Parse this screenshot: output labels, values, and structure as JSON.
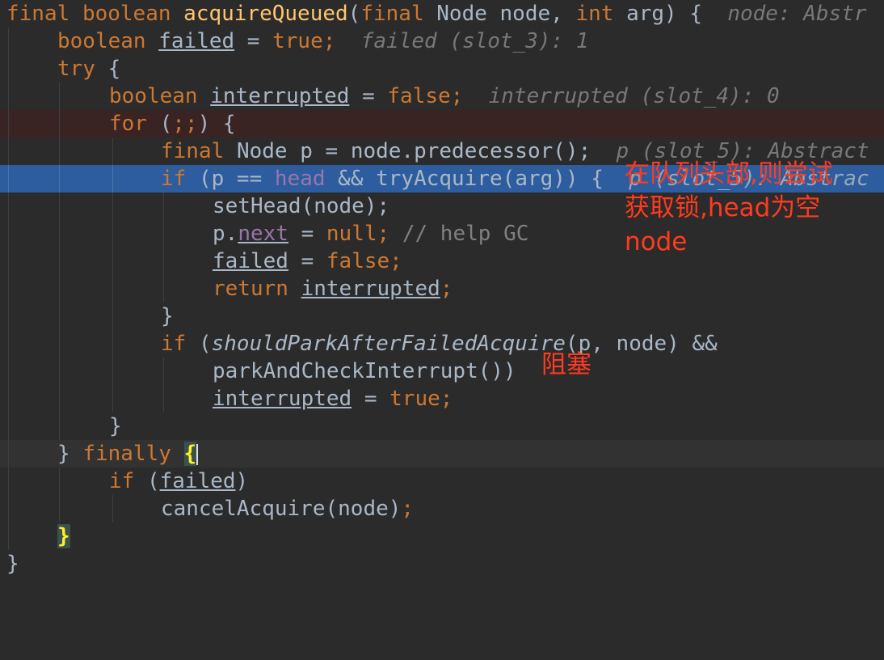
{
  "code": {
    "l1": {
      "kw_final": "final",
      "kw_boolean": "boolean",
      "method": "acquireQueued",
      "paren": "(",
      "kw_final2": "final",
      "type_node": "Node node,",
      "kw_int": "int",
      "param_arg": "arg) {",
      "hint": "node: Abstr"
    },
    "l2": {
      "kw_boolean": "boolean",
      "var": "failed",
      "assign": " = ",
      "kw_true": "true",
      "semi": ";",
      "hint": "failed (slot_3): 1"
    },
    "l3": {
      "kw_try": "try",
      "brace": " {"
    },
    "l4": {
      "kw_boolean": "boolean",
      "var": "interrupted",
      "assign": " = ",
      "kw_false": "false",
      "semi": ";",
      "hint": "interrupted (slot_4): 0"
    },
    "l5": {
      "kw_for": "for",
      "rest": " (",
      "semis": ";;",
      "close": ") {"
    },
    "l6": {
      "kw_final": "final",
      "decl": "Node p = node.predecessor();",
      "hint": "p (slot_5): Abstract"
    },
    "l7": {
      "kw_if": "if",
      "open": " (p == ",
      "field_head": "head",
      "rest": " && tryAcquire(arg)) {",
      "hint": "p (slot_5): Abstrac"
    },
    "l8": {
      "stmt": "setHead(node);"
    },
    "l9": {
      "p": "p.",
      "field_next": "next",
      "assign": " = ",
      "kw_null": "null",
      "semi": ";",
      "comment": "// help GC"
    },
    "l10": {
      "var": "failed",
      "assign": " = ",
      "kw_false": "false",
      "semi": ";"
    },
    "l11": {
      "kw_return": "return",
      "var": "interrupted",
      "semi": ";"
    },
    "l12": {
      "brace": "}"
    },
    "l13": {
      "kw_if": "if",
      "open": " (",
      "call": "shouldParkAfterFailedAcquire",
      "args": "(p, node) &&"
    },
    "l14": {
      "stmt": "parkAndCheckInterrupt())"
    },
    "l15": {
      "var": "interrupted",
      "assign": " = ",
      "kw_true": "true",
      "semi": ";"
    },
    "l16": {
      "brace": "}"
    },
    "l17": {
      "brace": "}",
      "kw_finally": "finally",
      "brace2": "{"
    },
    "l18": {
      "kw_if": "if",
      "open": " (",
      "var": "failed",
      "close": ")"
    },
    "l19": {
      "stmt": "cancelAcquire(node)",
      "semi": ";"
    },
    "l20": {
      "brace": "}"
    },
    "l21": {
      "brace": "}"
    }
  },
  "annotations": {
    "head_note": [
      "在队列头部,则尝试",
      "获取锁,head为空",
      "node"
    ],
    "park_note": "阻塞"
  }
}
